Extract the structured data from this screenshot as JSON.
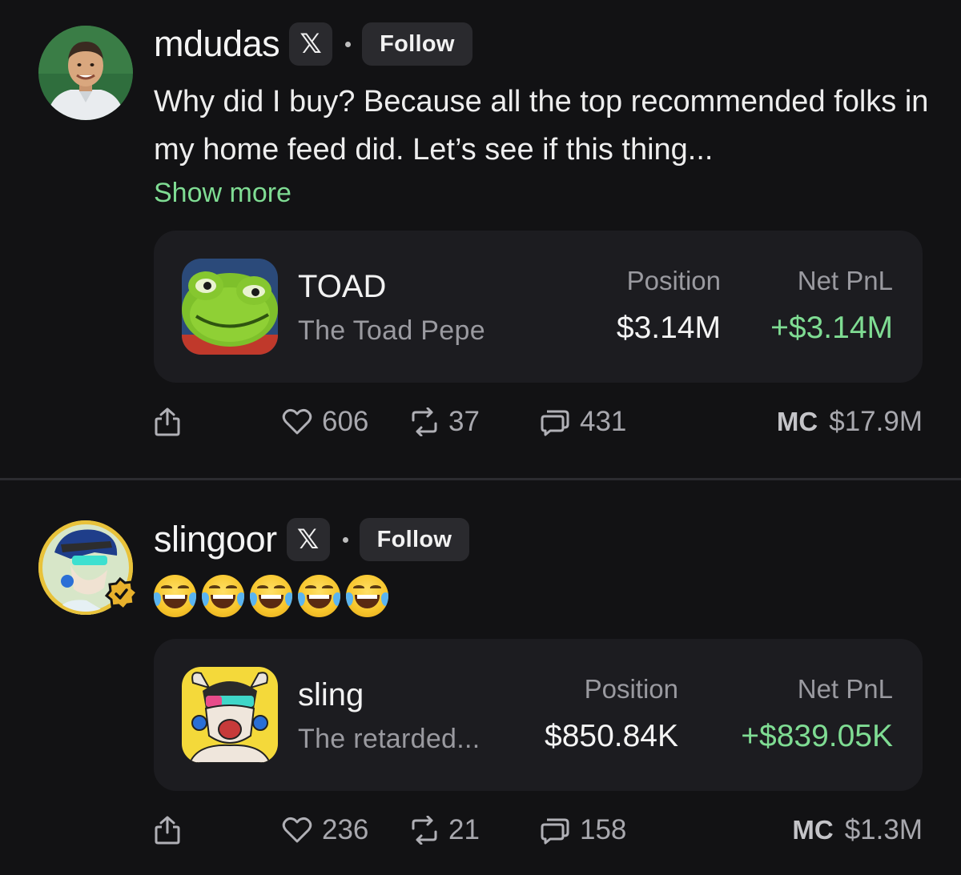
{
  "posts": [
    {
      "username": "mdudas",
      "x_badge": "𝕏",
      "follow_label": "Follow",
      "text": "Why did I buy? Because all the top recommended folks in my home feed did. Let’s see if this thing...",
      "show_more": "Show more",
      "token": {
        "symbol": "TOAD",
        "name": "The Toad Pepe",
        "position_label": "Position",
        "position_value": "$3.14M",
        "pnl_label": "Net PnL",
        "pnl_value": "+$3.14M"
      },
      "stats": {
        "likes": "606",
        "reposts": "37",
        "comments": "431"
      },
      "mc_label": "MC",
      "mc_value": "$17.9M"
    },
    {
      "username": "slingoor",
      "x_badge": "𝕏",
      "follow_label": "Follow",
      "emoji_count": 5,
      "token": {
        "symbol": "sling",
        "name": "The retarded...",
        "position_label": "Position",
        "position_value": "$850.84K",
        "pnl_label": "Net PnL",
        "pnl_value": "+$839.05K"
      },
      "stats": {
        "likes": "236",
        "reposts": "21",
        "comments": "158"
      },
      "mc_label": "MC",
      "mc_value": "$1.3M"
    }
  ],
  "colors": {
    "background": "#121214",
    "card": "#1c1c20",
    "accent_green": "#7fdc93",
    "muted_text": "#9a9aa0"
  }
}
